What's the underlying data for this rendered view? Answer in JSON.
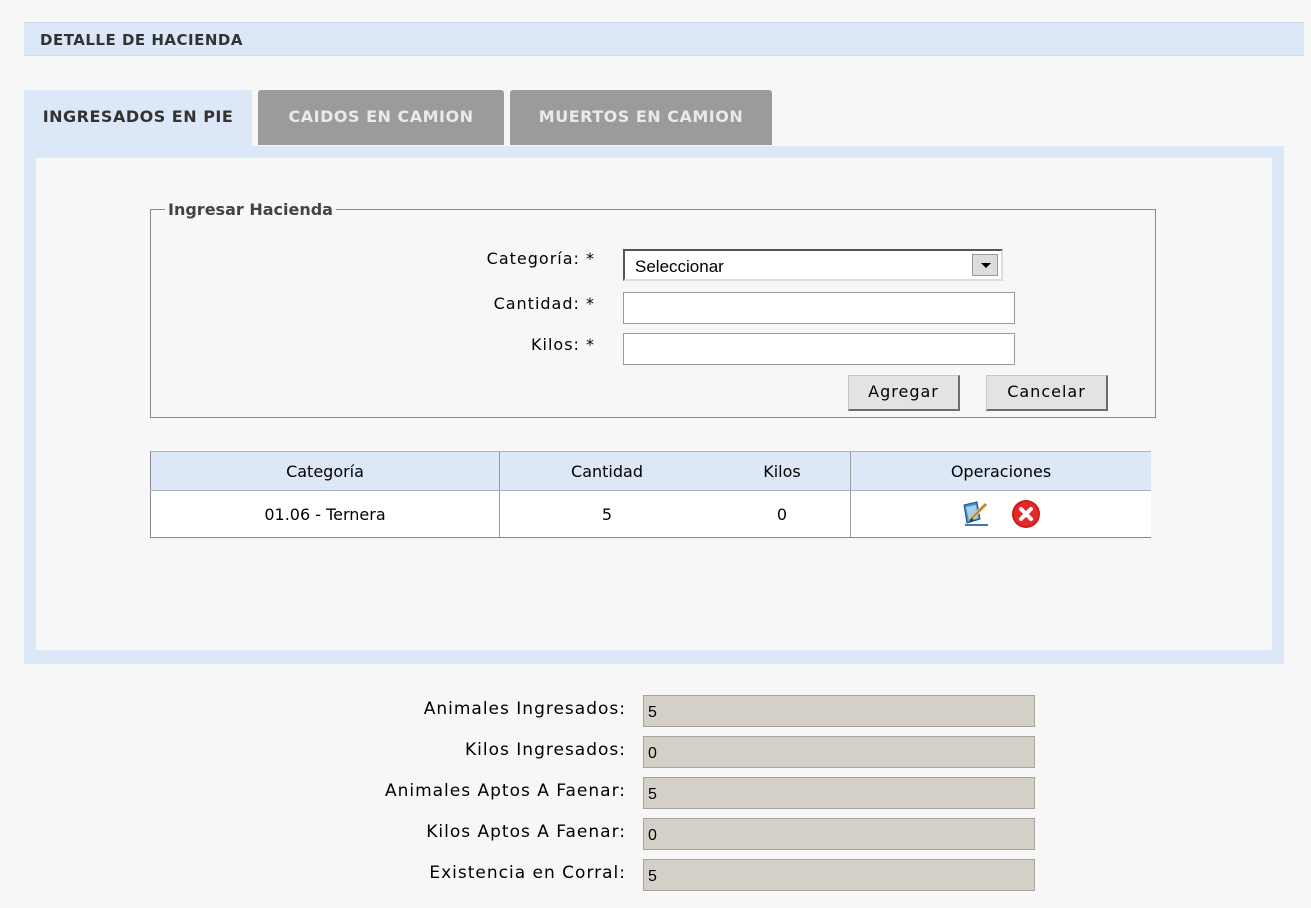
{
  "header": {
    "title": "DETALLE DE HACIENDA"
  },
  "tabs": [
    {
      "label": "INGRESADOS EN PIE",
      "active": true
    },
    {
      "label": "CAIDOS EN CAMION",
      "active": false
    },
    {
      "label": "MUERTOS EN CAMION",
      "active": false
    }
  ],
  "form": {
    "legend": "Ingresar Hacienda",
    "categoria_label": "Categoría: *",
    "categoria_value": "Seleccionar",
    "cantidad_label": "Cantidad: *",
    "cantidad_value": "",
    "kilos_label": "Kilos: *",
    "kilos_value": "",
    "agregar_label": "Agregar",
    "cancelar_label": "Cancelar"
  },
  "table": {
    "columns": [
      "Categoría",
      "Cantidad",
      "Kilos",
      "Operaciones"
    ],
    "rows": [
      {
        "categoria": "01.06 - Ternera",
        "cantidad": "5",
        "kilos": "0"
      }
    ]
  },
  "summary": {
    "animales_ingresados_label": "Animales Ingresados:",
    "animales_ingresados_value": "5",
    "kilos_ingresados_label": "Kilos Ingresados:",
    "kilos_ingresados_value": "0",
    "animales_aptos_label": "Animales Aptos A Faenar:",
    "animales_aptos_value": "5",
    "kilos_aptos_label": "Kilos Aptos A Faenar:",
    "kilos_aptos_value": "0",
    "existencia_label": "Existencia en Corral:",
    "existencia_value": "5"
  },
  "icons": {
    "edit": "edit-icon",
    "delete": "delete-icon"
  },
  "colors": {
    "header_bg": "#dce8f7",
    "inactive_tab": "#9b9b9b",
    "readonly_field": "#d4d0c8",
    "delete_red": "#d8141e"
  }
}
